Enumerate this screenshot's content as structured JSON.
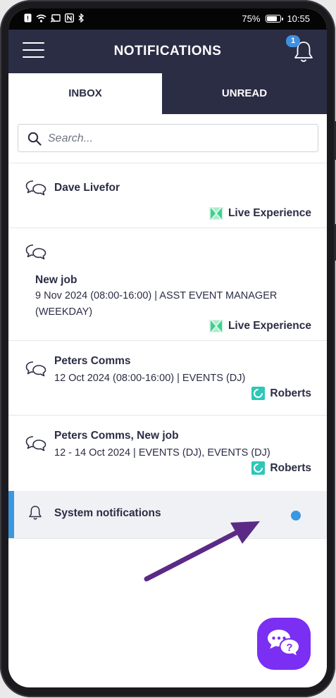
{
  "status_bar": {
    "battery_percent": "75%",
    "time": "10:55",
    "left_icons": [
      "notification-icon",
      "wifi-icon",
      "cast-icon",
      "nfc-icon",
      "bluetooth-icon"
    ]
  },
  "header": {
    "title": "NOTIFICATIONS",
    "bell_badge": "1"
  },
  "tabs": [
    {
      "label": "INBOX",
      "active": true
    },
    {
      "label": "UNREAD",
      "active": false
    }
  ],
  "search": {
    "placeholder": "Search..."
  },
  "notifications": [
    {
      "title": "Dave Livefor",
      "detail": "",
      "company": "Live Experience",
      "logo": "live-experience-logo"
    },
    {
      "title": "New job",
      "detail": "9 Nov 2024 (08:00-16:00) | ASST EVENT MANAGER (WEEKDAY)",
      "company": "Live Experience",
      "logo": "live-experience-logo"
    },
    {
      "title": "Peters Comms",
      "detail": "12 Oct 2024 (08:00-16:00) | EVENTS (DJ)",
      "company": "Roberts",
      "logo": "roberts-logo"
    },
    {
      "title": "Peters Comms, New job",
      "detail": "12 - 14 Oct 2024 | EVENTS (DJ), EVENTS (DJ)",
      "company": "Roberts",
      "logo": "roberts-logo"
    }
  ],
  "system_notifications": {
    "label": "System notifications",
    "unread_dot_color": "#3b97e0"
  },
  "colors": {
    "header_bg": "#2b2d45",
    "accent_blue": "#3b97e0",
    "fab_purple": "#7b2ff2",
    "annotation_arrow": "#5b2a86"
  }
}
